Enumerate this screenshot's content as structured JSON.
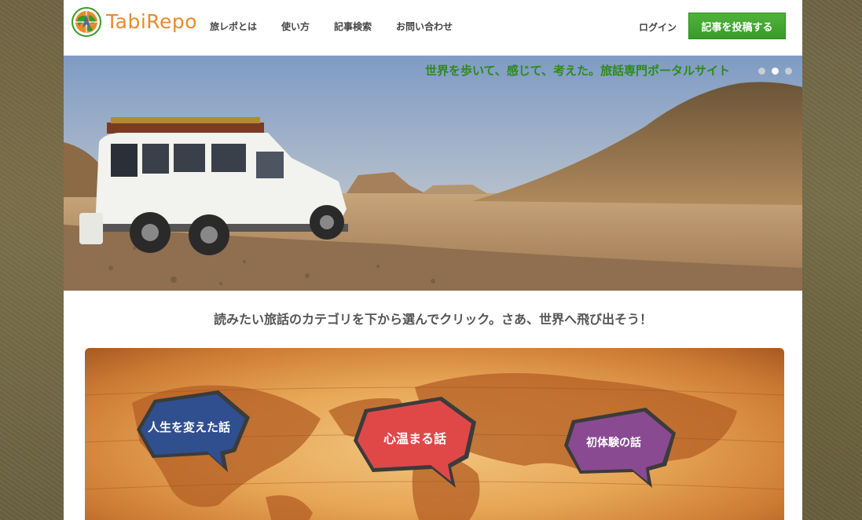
{
  "header": {
    "logo_text": "TabiRepo",
    "nav": [
      {
        "label": "旅レポとは"
      },
      {
        "label": "使い方"
      },
      {
        "label": "記事検索"
      },
      {
        "label": "お問い合わせ"
      }
    ],
    "login_label": "ログイン",
    "post_label": "記事を投稿する"
  },
  "hero": {
    "tagline": "世界を歩いて、感じて、考えた。旅話専門ポータルサイト",
    "slides_count": 3,
    "active_slide": 2
  },
  "main": {
    "lead": "読みたい旅話のカテゴリを下から選んでクリック。さあ、世界へ飛び出そう！",
    "categories": [
      {
        "label": "人生を変えた話",
        "color": "#2f4f8f"
      },
      {
        "label": "心温まる話",
        "color": "#e04848"
      },
      {
        "label": "初体験の話",
        "color": "#8a4a92"
      }
    ]
  },
  "colors": {
    "accent_green": "#3a9a2a",
    "logo_orange": "#e98a2c",
    "tagline_green": "#2d8a1f"
  }
}
